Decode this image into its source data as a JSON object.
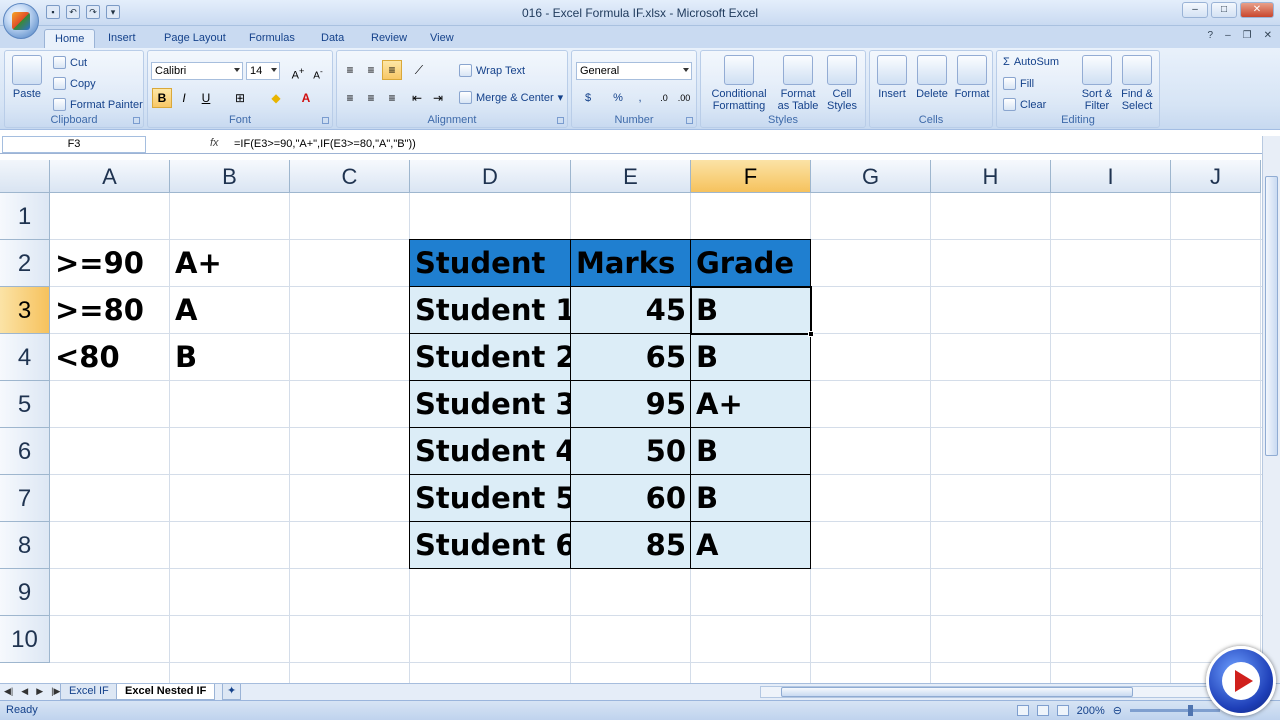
{
  "window": {
    "title": "016 - Excel Formula IF.xlsx - Microsoft Excel"
  },
  "qat": {
    "save": "save-icon",
    "undo": "undo-icon",
    "redo": "redo-icon"
  },
  "tabs": [
    "Home",
    "Insert",
    "Page Layout",
    "Formulas",
    "Data",
    "Review",
    "View"
  ],
  "ribbon": {
    "clipboard": {
      "label": "Clipboard",
      "paste": "Paste",
      "cut": "Cut",
      "copy": "Copy",
      "format_painter": "Format Painter"
    },
    "font": {
      "label": "Font",
      "family": "Calibri",
      "size": "14",
      "bold": "B",
      "italic": "I",
      "underline": "U"
    },
    "alignment": {
      "label": "Alignment",
      "wrap": "Wrap Text",
      "merge": "Merge & Center"
    },
    "number": {
      "label": "Number",
      "format": "General",
      "currency": "$",
      "percent": "%",
      "comma": ","
    },
    "styles": {
      "label": "Styles",
      "conditional": "Conditional",
      "conditional2": "Formatting",
      "format_table": "Format",
      "format_table2": "as Table",
      "cell_styles": "Cell",
      "cell_styles2": "Styles"
    },
    "cells": {
      "label": "Cells",
      "insert": "Insert",
      "delete": "Delete",
      "format": "Format"
    },
    "editing": {
      "label": "Editing",
      "autosum": "AutoSum",
      "fill": "Fill",
      "clear": "Clear",
      "sort": "Sort &",
      "sort2": "Filter",
      "find": "Find &",
      "find2": "Select"
    }
  },
  "formula_bar": {
    "name_box": "F3",
    "fx": "fx",
    "formula": "=IF(E3>=90,\"A+\",IF(E3>=80,\"A\",\"B\"))"
  },
  "columns": [
    "A",
    "B",
    "C",
    "D",
    "E",
    "F",
    "G",
    "H",
    "I",
    "J"
  ],
  "rows": [
    "1",
    "2",
    "3",
    "4",
    "5",
    "6",
    "7",
    "8",
    "9",
    "10"
  ],
  "criteria": [
    {
      "cond": ">=90",
      "grade": "A+"
    },
    {
      "cond": ">=80",
      "grade": "A"
    },
    {
      "cond": "<80",
      "grade": "B"
    }
  ],
  "table": {
    "headers": [
      "Student",
      "Marks",
      "Grade"
    ],
    "rows": [
      {
        "student": "Student 1",
        "marks": "45",
        "grade": "B"
      },
      {
        "student": "Student 2",
        "marks": "65",
        "grade": "B"
      },
      {
        "student": "Student 3",
        "marks": "95",
        "grade": "A+"
      },
      {
        "student": "Student 4",
        "marks": "50",
        "grade": "B"
      },
      {
        "student": "Student 5",
        "marks": "60",
        "grade": "B"
      },
      {
        "student": "Student 6",
        "marks": "85",
        "grade": "A"
      }
    ]
  },
  "sheets": [
    "Excel IF",
    "Excel Nested IF"
  ],
  "active_sheet": "Excel Nested IF",
  "status": {
    "ready": "Ready",
    "zoom": "200%"
  },
  "colors": {
    "header_fill": "#1f7fd0",
    "body_fill": "#dcedf7",
    "selection": "#f6c25d"
  }
}
